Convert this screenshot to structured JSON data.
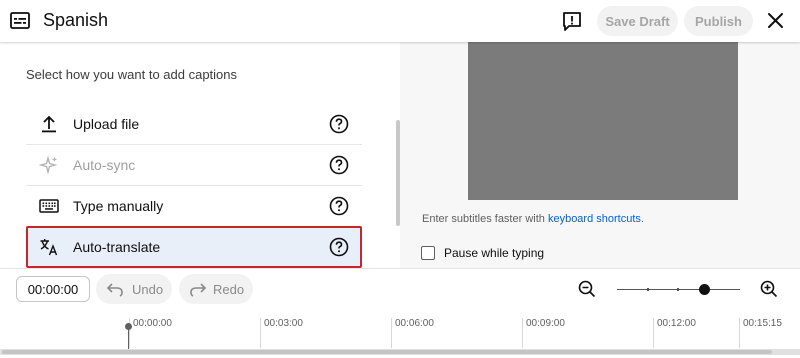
{
  "header": {
    "title": "Spanish",
    "save_label": "Save Draft",
    "publish_label": "Publish",
    "icon": "subtitles-icon"
  },
  "left_panel": {
    "title": "Select how you want to add captions",
    "options": [
      {
        "label": "Upload file",
        "icon": "upload-icon",
        "state": "normal"
      },
      {
        "label": "Auto-sync",
        "icon": "sparkle-icon",
        "state": "disabled"
      },
      {
        "label": "Type manually",
        "icon": "keyboard-icon",
        "state": "normal"
      },
      {
        "label": "Auto-translate",
        "icon": "translate-icon",
        "state": "selected"
      }
    ]
  },
  "right_panel": {
    "hint_prefix": "Enter subtitles faster with ",
    "hint_link": "keyboard shortcuts",
    "hint_suffix": ".",
    "pause_label": "Pause while typing",
    "pause_checked": false
  },
  "toolbar": {
    "time": "00:00:00",
    "undo_label": "Undo",
    "redo_label": "Redo",
    "zoom_level": 0.71
  },
  "timeline": {
    "marks": [
      "00:00:00",
      "00:03:00",
      "00:06:00",
      "00:09:00",
      "00:12:00",
      "00:15:15"
    ]
  },
  "colors": {
    "selected_border": "#c1272d",
    "selected_bg": "#e8eff9",
    "link": "#065fd4",
    "video_placeholder": "#7b7b7b"
  }
}
